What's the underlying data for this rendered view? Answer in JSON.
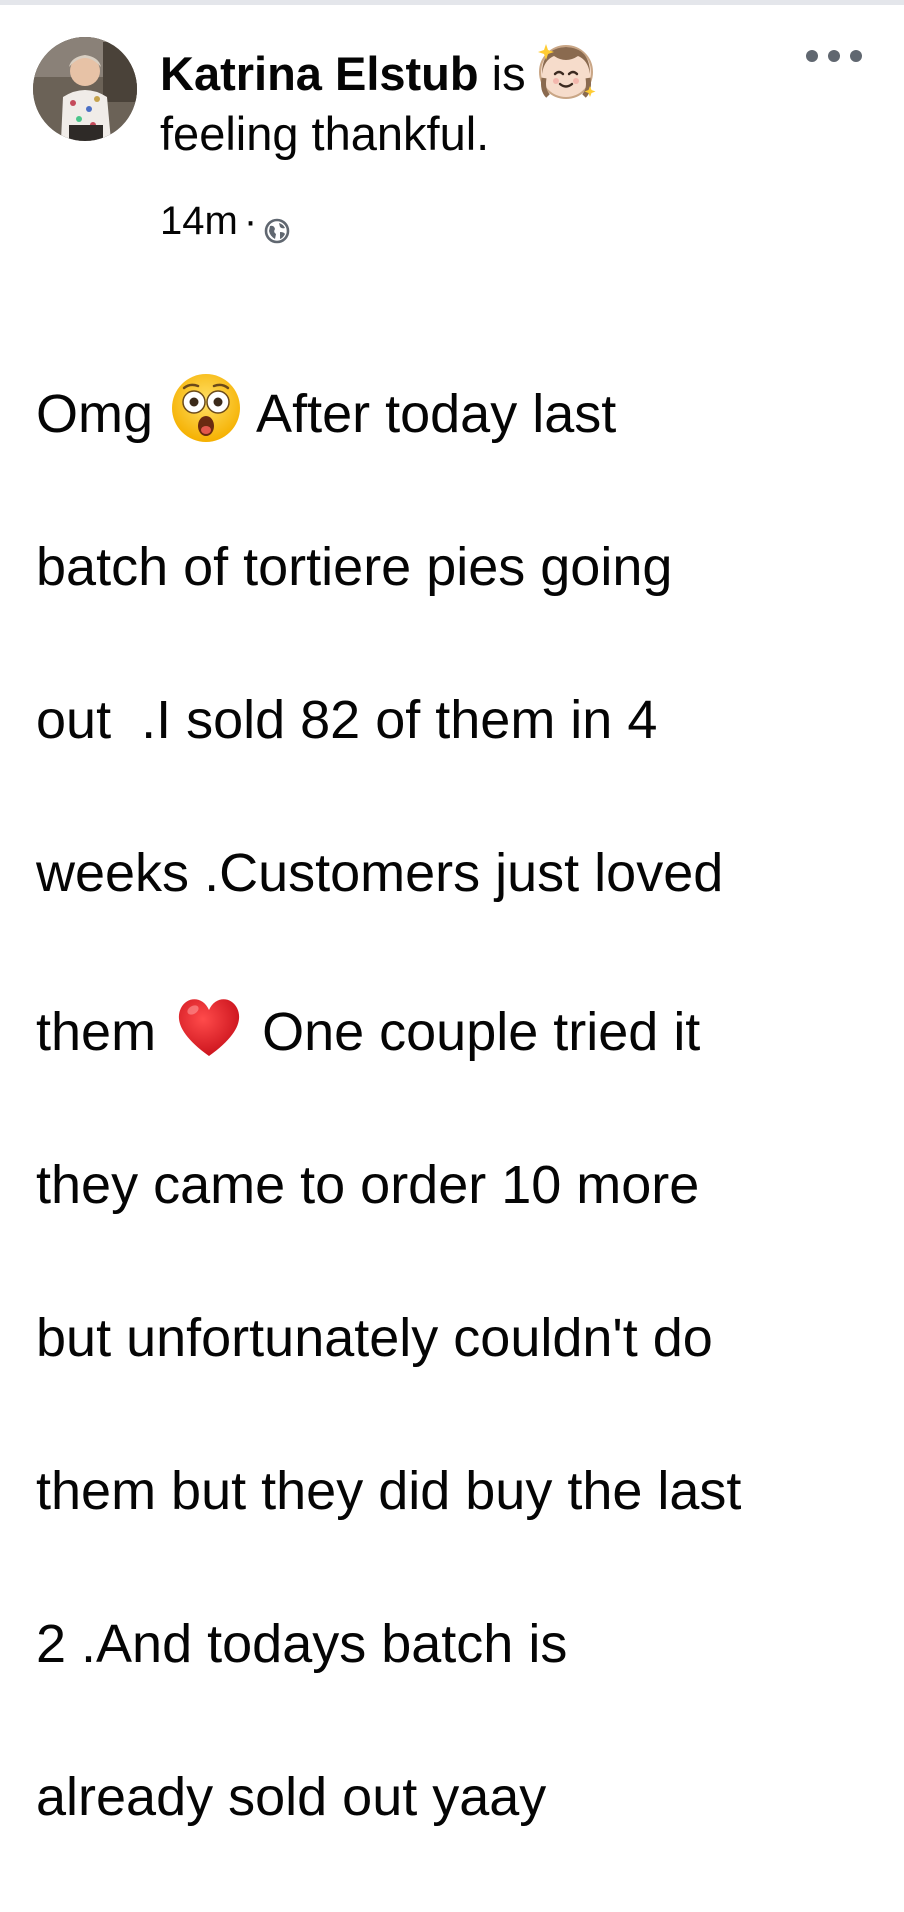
{
  "post": {
    "author": "Katrina Elstub",
    "feeling_prefix": " is",
    "feeling_text": "feeling thankful.",
    "feeling_emoji": "angel-face-emoji",
    "timestamp": "14m",
    "separator": "·",
    "audience_icon": "globe-icon",
    "more_icon": "more-options-icon",
    "body_lines": {
      "l1_a": "Omg ",
      "l1_emoji": "astonished-face-emoji",
      "l1_b": " After today last",
      "l2": "batch of tortiere pies going",
      "l3": "out  .I sold 82 of them in 4",
      "l4": "weeks .Customers just loved",
      "l5_a": "them ",
      "l5_emoji": "red-heart-emoji",
      "l5_b": " One couple tried it",
      "l6": "they came to order 10 more",
      "l7": "but unfortunately couldn't do",
      "l8": "them but they did buy the last",
      "l9": "2 .And todays batch is",
      "l10": "already sold out yaay"
    },
    "colors": {
      "text": "#050505",
      "meta_icon": "#606770",
      "heart": "#e0191e",
      "emoji_yellow": "#ffcc33"
    }
  }
}
